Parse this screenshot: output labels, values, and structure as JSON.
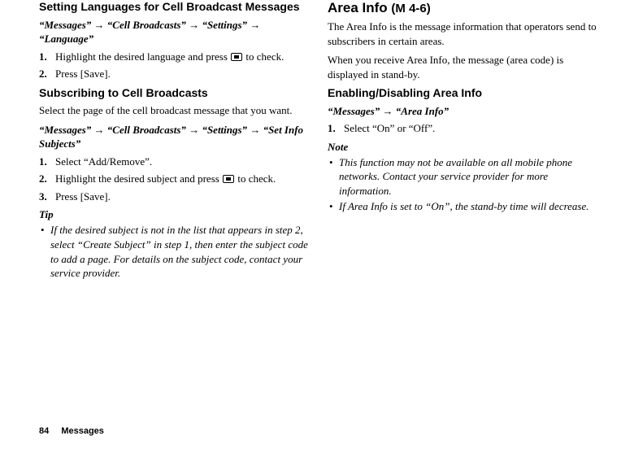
{
  "left": {
    "lang_heading": "Setting Languages for Cell Broadcast Messages",
    "lang_path_m": "“Messages”",
    "lang_path_cb": "“Cell Broadcasts”",
    "lang_path_set": "“Settings”",
    "lang_path_lang": "“Language”",
    "lang_step1a": "Highlight the desired language and press ",
    "lang_step1b": " to check.",
    "lang_step2": "Press [Save].",
    "sub_heading": "Subscribing to Cell Broadcasts",
    "sub_intro": "Select the page of the cell broadcast message that you want.",
    "sub_path_m": "“Messages”",
    "sub_path_cb": "“Cell Broadcasts”",
    "sub_path_set": "“Settings”",
    "sub_path_si": "“Set Info Subjects”",
    "sub_step1": "Select “Add/Remove”.",
    "sub_step2a": "Highlight the desired subject and press ",
    "sub_step2b": " to check.",
    "sub_step3": "Press [Save].",
    "tip_label": "Tip",
    "tip_body": "If the desired subject is not in the list that appears in step 2, select “Create Subject” in step 1, then enter the subject code to add a page. For details on the subject code, contact your service provider."
  },
  "right": {
    "area_heading": "Area Info ",
    "area_menu": "(M 4-6)",
    "area_body1": "The Area Info is the message information that operators send to subscribers in certain areas.",
    "area_body2": "When you receive Area Info, the message (area code) is displayed in stand-by.",
    "enable_heading": "Enabling/Disabling Area Info",
    "enable_path_m": "“Messages”",
    "enable_path_ai": "“Area Info”",
    "enable_step1": "Select “On” or “Off”.",
    "note_label": "Note",
    "note1": "This function may not be available on all mobile phone networks. Contact your service provider for more information.",
    "note2": "If Area Info is set to “On”, the stand-by time will decrease."
  },
  "footer": {
    "page": "84",
    "section": "Messages"
  },
  "arrow": "→"
}
